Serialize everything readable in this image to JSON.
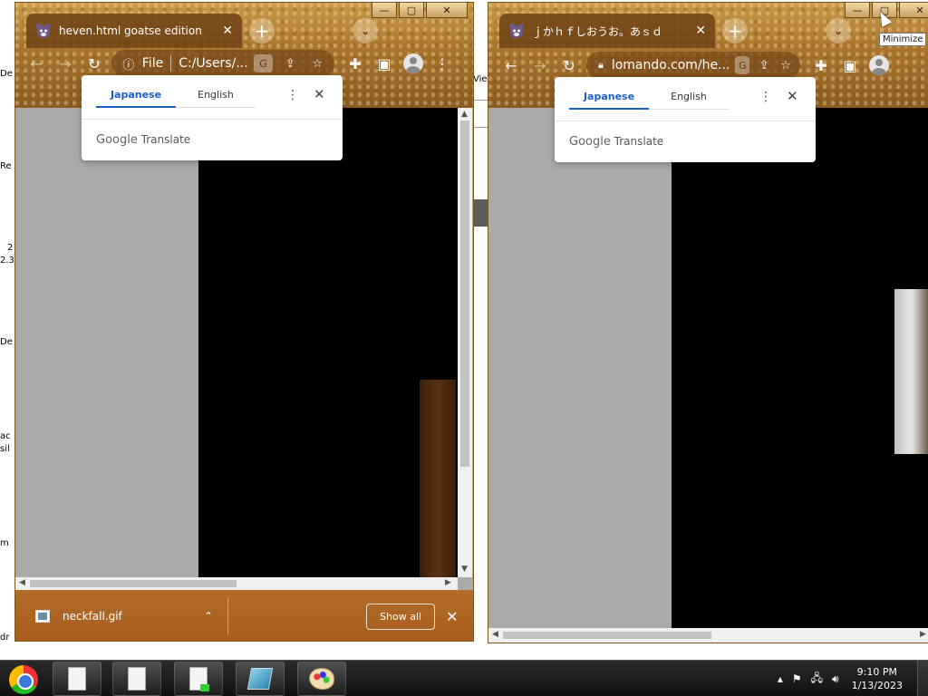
{
  "desktop": {
    "left_fragments": [
      "De",
      "Re",
      "2",
      "2.3",
      "De",
      "ac",
      "sil",
      "m",
      "dr"
    ],
    "middle_fragment": "Vie"
  },
  "window1": {
    "tab_title": "heven.html goatse edition",
    "address_scheme": "File",
    "address_text": "C:/Users/...",
    "translate": {
      "tab_source": "Japanese",
      "tab_target": "English",
      "brand_google": "Google",
      "brand_translate": "Translate"
    },
    "download": {
      "filename": "neckfall.gif",
      "show_all": "Show all"
    }
  },
  "window2": {
    "tab_title": "ｊかｈｆしおうお。あｓｄ",
    "address_text": "lomando.com/he...",
    "translate": {
      "tab_source": "Japanese",
      "tab_target": "English",
      "brand_google": "Google",
      "brand_translate": "Translate"
    },
    "tooltip": "Minimize"
  },
  "icons": {
    "minimize": "—",
    "maximize": "▢",
    "close": "✕",
    "back": "←",
    "forward": "→",
    "reload": "↻",
    "info": "ⓘ",
    "lock": "🔒",
    "star": "☆",
    "menu": "⋮",
    "plus": "+",
    "chevron_down": "⌄",
    "chevron_up": "⌃"
  },
  "taskbar": {
    "time": "9:10 PM",
    "date": "1/13/2023"
  },
  "colors": {
    "theme_brown": "#a8742e",
    "translate_accent": "#1a5fc5",
    "content_gray": "#aaaaaa"
  }
}
